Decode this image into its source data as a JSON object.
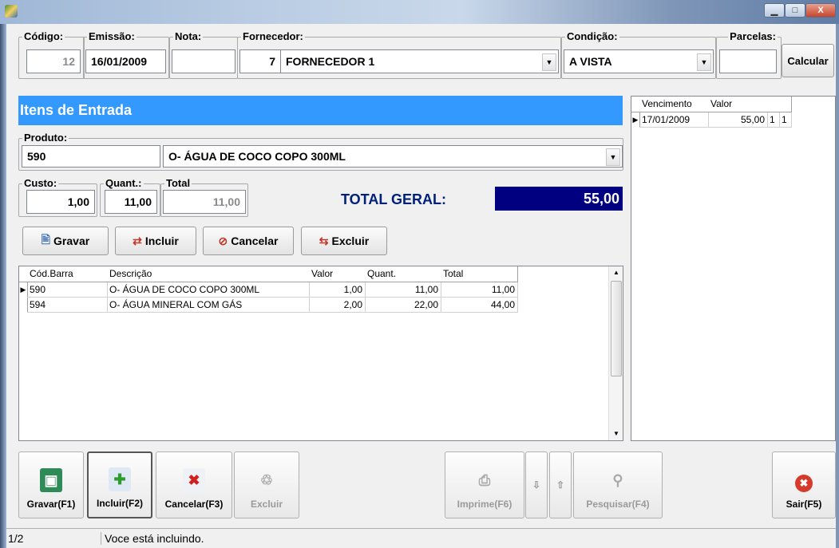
{
  "window": {
    "minimize": "▁",
    "maximize": "□",
    "close": "X"
  },
  "header": {
    "codigo_label": "Código:",
    "codigo_value": "12",
    "emissao_label": "Emissão:",
    "emissao_value": "16/01/2009",
    "nota_label": "Nota:",
    "nota_value": "",
    "fornecedor_label": "Fornecedor:",
    "fornecedor_code": "7",
    "fornecedor_name": "FORNECEDOR 1",
    "condicao_label": "Condição:",
    "condicao_value": "A VISTA",
    "parcelas_label": "Parcelas:",
    "parcelas_value": "",
    "calcular_label": "Calcular"
  },
  "itens": {
    "title": "Itens de Entrada",
    "produto_label": "Produto:",
    "produto_code": "590",
    "produto_desc": "O- ÁGUA DE COCO COPO 300ML",
    "custo_label": "Custo:",
    "custo_value": "1,00",
    "quant_label": "Quant.:",
    "quant_value": "11,00",
    "total_label": "Total",
    "total_value": "11,00",
    "total_geral_label": "TOTAL GERAL:",
    "total_geral_value": "55,00"
  },
  "actions": {
    "gravar": "Gravar",
    "incluir": "Incluir",
    "cancelar": "Cancelar",
    "excluir": "Excluir"
  },
  "items_grid": {
    "columns": [
      "Cód.Barra",
      "Descrição",
      "Valor",
      "Quant.",
      "Total"
    ],
    "rows": [
      [
        "590",
        "O- ÁGUA DE COCO COPO 300ML",
        "1,00",
        "11,00",
        "11,00"
      ],
      [
        "594",
        "O- ÁGUA MINERAL COM GÁS",
        "2,00",
        "22,00",
        "44,00"
      ]
    ]
  },
  "parcelas_grid": {
    "columns": [
      "Vencimento",
      "Valor",
      "",
      ""
    ],
    "rows": [
      [
        "17/01/2009",
        "55,00",
        "1",
        "1"
      ]
    ]
  },
  "toolbar": {
    "gravar": "Gravar(F1)",
    "incluir": "Incluir(F2)",
    "cancelar": "Cancelar(F3)",
    "excluir": "Excluir",
    "imprime": "Imprime(F6)",
    "pesquisar": "Pesquisar(F4)",
    "sair": "Sair(F5)"
  },
  "status": {
    "record": "1/2",
    "message": "Voce está incluindo."
  },
  "colors": {
    "header_blue": "#3399ff",
    "total_navy": "#000080",
    "total_text": "#00207a"
  }
}
